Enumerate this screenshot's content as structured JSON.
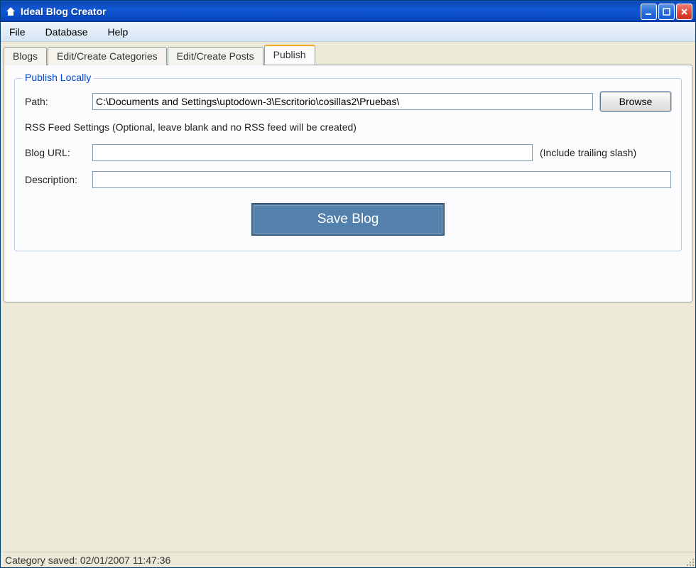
{
  "window": {
    "title": "Ideal Blog Creator"
  },
  "menu": {
    "file": "File",
    "database": "Database",
    "help": "Help"
  },
  "tabs": {
    "blogs": "Blogs",
    "categories": "Edit/Create Categories",
    "posts": "Edit/Create Posts",
    "publish": "Publish"
  },
  "publish": {
    "group_title": "Publish Locally",
    "path_label": "Path:",
    "path_value": "C:\\Documents and Settings\\uptodown-3\\Escritorio\\cosillas2\\Pruebas\\",
    "browse_label": "Browse",
    "rss_note": "RSS Feed Settings (Optional, leave blank and no RSS feed will be created)",
    "blogurl_label": "Blog URL:",
    "blogurl_value": "",
    "blogurl_hint": "(Include trailing slash)",
    "description_label": "Description:",
    "description_value": "",
    "save_label": "Save Blog"
  },
  "status": {
    "text": "Category saved: 02/01/2007 11:47:36"
  }
}
